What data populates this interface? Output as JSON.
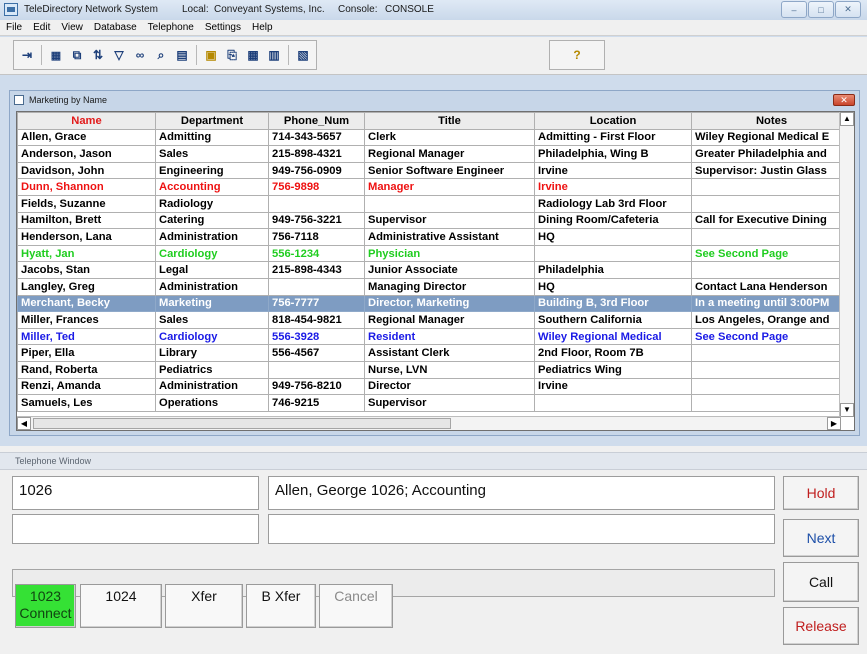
{
  "window": {
    "title": "TeleDirectory Network System",
    "local_label": "Local:",
    "local_value": "Conveyant Systems, Inc.",
    "console_label": "Console:",
    "console_value": "CONSOLE",
    "controls": {
      "minimize": "–",
      "maximize": "□",
      "close": "✕"
    }
  },
  "menu": [
    "File",
    "Edit",
    "View",
    "Database",
    "Telephone",
    "Settings",
    "Help"
  ],
  "toolbar": {
    "icons": [
      "exit-icon",
      "grid-icon",
      "window-icon",
      "sort-icon",
      "filter-icon",
      "binoculars-icon",
      "search-icon",
      "list-icon",
      "copy-folder-icon",
      "paste-icon",
      "table-icon",
      "form-icon",
      "report-icon",
      "help-icon"
    ]
  },
  "directory": {
    "title": "Marketing by Name",
    "columns": [
      "Name",
      "Department",
      "Phone_Num",
      "Title",
      "Location",
      "Notes"
    ],
    "rows": [
      {
        "color": "black",
        "cells": [
          "Allen, Grace",
          "Admitting",
          "714-343-5657",
          "Clerk",
          "Admitting - First Floor",
          "Wiley Regional Medical E"
        ]
      },
      {
        "color": "black",
        "cells": [
          "Anderson, Jason",
          "Sales",
          "215-898-4321",
          "Regional Manager",
          "Philadelphia, Wing B",
          "Greater Philadelphia and"
        ]
      },
      {
        "color": "black",
        "cells": [
          "Davidson, John",
          "Engineering",
          "949-756-0909",
          "Senior Software Engineer",
          "Irvine",
          "Supervisor:  Justin Glass"
        ]
      },
      {
        "color": "red",
        "cells": [
          "Dunn, Shannon",
          "Accounting",
          "756-9898",
          "Manager",
          "Irvine",
          ""
        ]
      },
      {
        "color": "black",
        "cells": [
          "Fields, Suzanne",
          "Radiology",
          "",
          "",
          "Radiology Lab 3rd Floor",
          ""
        ]
      },
      {
        "color": "black",
        "cells": [
          "Hamilton, Brett",
          "Catering",
          "949-756-3221",
          "Supervisor",
          "Dining Room/Cafeteria",
          "Call for Executive Dining"
        ]
      },
      {
        "color": "black",
        "cells": [
          "Henderson, Lana",
          "Administration",
          "756-7118",
          "Administrative Assistant",
          "HQ",
          ""
        ]
      },
      {
        "color": "green",
        "cells": [
          "Hyatt, Jan",
          "Cardiology",
          "556-1234",
          "Physician",
          "",
          "See Second Page"
        ]
      },
      {
        "color": "black",
        "cells": [
          "Jacobs, Stan",
          "Legal",
          "215-898-4343",
          "Junior Associate",
          "Philadelphia",
          ""
        ]
      },
      {
        "color": "black",
        "cells": [
          "Langley, Greg",
          "Administration",
          "",
          "Managing Director",
          "HQ",
          "Contact Lana Henderson"
        ]
      },
      {
        "color": "selected",
        "cells": [
          "Merchant, Becky",
          "Marketing",
          "756-7777",
          "Director, Marketing",
          "Building B, 3rd Floor",
          "In a meeting until 3:00PM"
        ]
      },
      {
        "color": "black",
        "cells": [
          "Miller, Frances",
          "Sales",
          "818-454-9821",
          "Regional Manager",
          "Southern California",
          "Los Angeles, Orange and"
        ]
      },
      {
        "color": "blue",
        "cells": [
          "Miller, Ted",
          "Cardiology",
          "556-3928",
          "Resident",
          "Wiley Regional Medical",
          "See Second Page"
        ]
      },
      {
        "color": "black",
        "cells": [
          "Piper, Ella",
          "Library",
          "556-4567",
          "Assistant Clerk",
          "2nd Floor, Room 7B",
          ""
        ]
      },
      {
        "color": "black",
        "cells": [
          "Rand, Roberta",
          "Pediatrics",
          "",
          "Nurse, LVN",
          "Pediatrics Wing",
          ""
        ]
      },
      {
        "color": "black",
        "cells": [
          "Renzi, Amanda",
          "Administration",
          "949-756-8210",
          "Director",
          "Irvine",
          ""
        ]
      },
      {
        "color": "black",
        "cells": [
          "Samuels, Les",
          "Operations",
          "746-9215",
          "Supervisor",
          "",
          ""
        ]
      }
    ]
  },
  "telephone": {
    "title": "Telephone Window",
    "extension": "1026",
    "caller_info": "Allen, George 1026; Accounting",
    "line2_left": "",
    "line2_right": "",
    "status": "",
    "buttons": {
      "connect_ext": "1023",
      "connect_label": "Connect",
      "ext2": "1024",
      "xfer": "Xfer",
      "bxfer": "B Xfer",
      "cancel": "Cancel",
      "hold": "Hold",
      "next": "Next",
      "call": "Call",
      "release": "Release"
    }
  }
}
